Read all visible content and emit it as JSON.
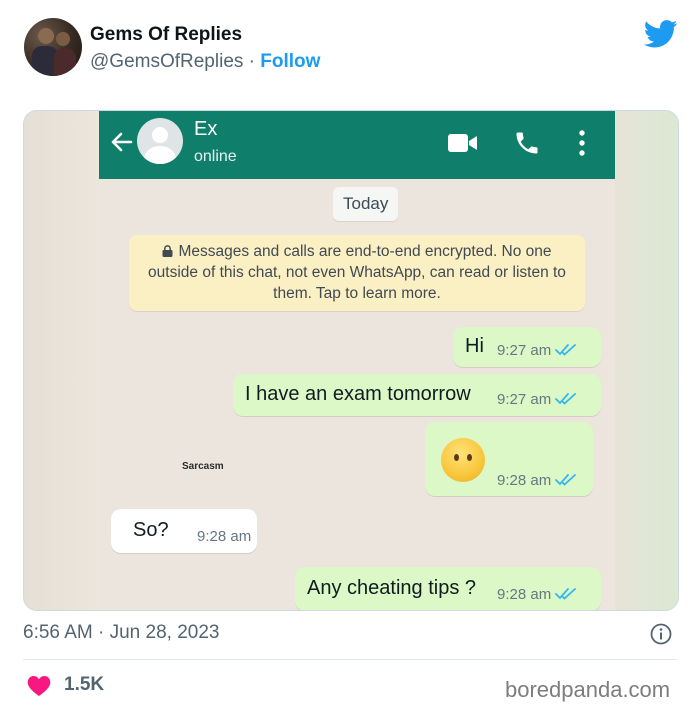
{
  "tweet": {
    "author_name": "Gems Of Replies",
    "handle": "@GemsOfReplies",
    "separator": " · ",
    "follow_label": "Follow",
    "timestamp": "6:56 AM · Jun 28, 2023",
    "likes": "1.5K",
    "watermark": "boredpanda.com"
  },
  "chat": {
    "contact_name": "Ex",
    "contact_status": "online",
    "date_chip": "Today",
    "encryption_note": "Messages and calls are end-to-end encrypted. No one outside of this chat, not even WhatsApp, can read or listen to them. Tap to learn more.",
    "caption": "Sarcasm",
    "messages": [
      {
        "direction": "out",
        "text": "Hi",
        "time": "9:27 am"
      },
      {
        "direction": "out",
        "text": "I have an exam tomorrow",
        "time": "9:27 am"
      },
      {
        "direction": "out",
        "text": "",
        "emoji": "neutral-face-emoji",
        "time": "9:28 am"
      },
      {
        "direction": "in",
        "text": "So?",
        "time": "9:28 am"
      },
      {
        "direction": "out",
        "text": "Any cheating tips ?",
        "time": "9:28 am"
      }
    ]
  },
  "colors": {
    "header_green": "#0f7f6c",
    "outgoing_bubble": "#dcf8c6",
    "incoming_bubble": "#ffffff",
    "read_ticks": "#34b7f1",
    "twitter_blue": "#1d9bf0",
    "heart": "#f91880"
  },
  "icons": [
    "twitter-bird-icon",
    "back-arrow-icon",
    "video-call-icon",
    "phone-icon",
    "more-vertical-icon",
    "lock-icon",
    "double-tick-icon",
    "info-icon",
    "heart-icon"
  ]
}
